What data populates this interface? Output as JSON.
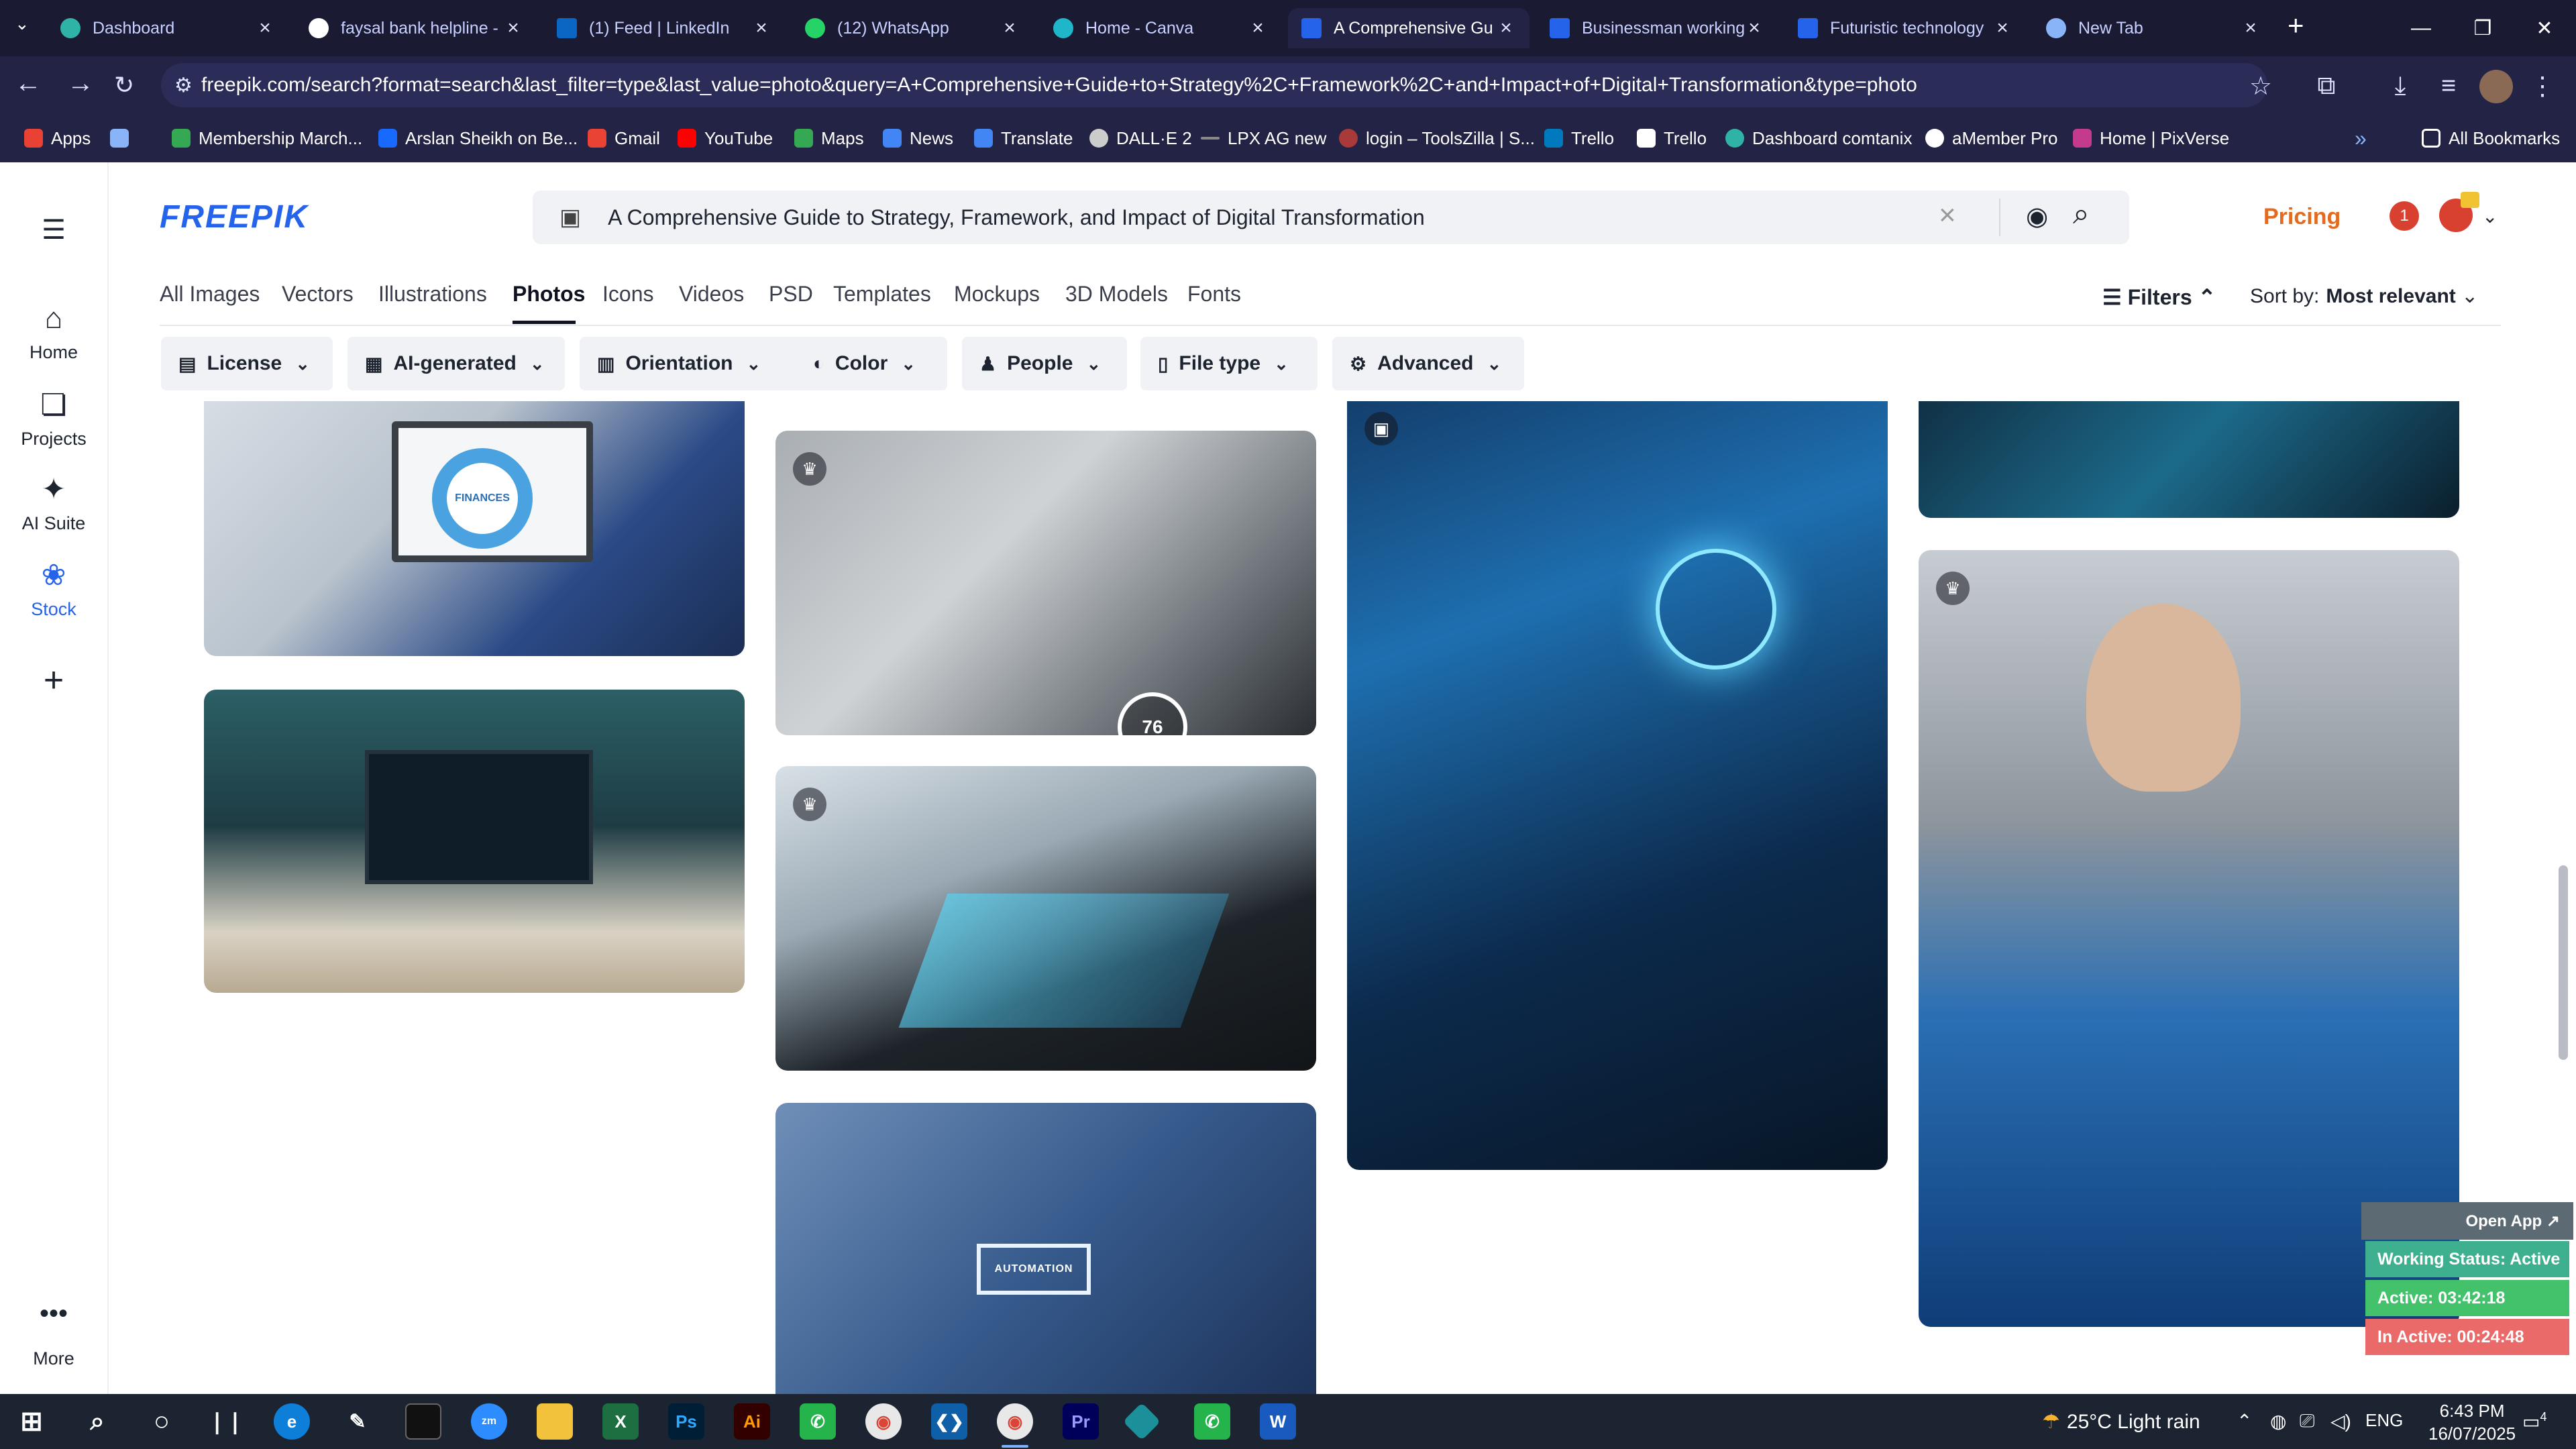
{
  "browser": {
    "tabs": [
      {
        "title": "Dashboard",
        "color": "#2fb3a6"
      },
      {
        "title": "faysal bank helpline -",
        "color": "#ffffff"
      },
      {
        "title": "(1) Feed | LinkedIn",
        "color": "#0a66c2"
      },
      {
        "title": "(12) WhatsApp",
        "color": "#25d366"
      },
      {
        "title": "Home - Canva",
        "color": "#1fb6c9"
      },
      {
        "title": "A Comprehensive Gu",
        "color": "#2563eb"
      },
      {
        "title": "Businessman working",
        "color": "#2563eb"
      },
      {
        "title": "Futuristic technology",
        "color": "#2563eb"
      },
      {
        "title": "New Tab",
        "color": "#8ab4f8"
      }
    ],
    "url": "freepik.com/search?format=search&last_filter=type&last_value=photo&query=A+Comprehensive+Guide+to+Strategy%2C+Framework%2C+and+Impact+of+Digital+Transformation&type=photo",
    "bookmarks": [
      {
        "label": "Apps",
        "color": "#e94235"
      },
      {
        "label": "",
        "color": "#8ab4f8"
      },
      {
        "label": "Membership March...",
        "color": "#34a853"
      },
      {
        "label": "Arslan Sheikh on Be...",
        "color": "#1769ff"
      },
      {
        "label": "Gmail",
        "color": "#ea4335"
      },
      {
        "label": "YouTube",
        "color": "#ff0000"
      },
      {
        "label": "Maps",
        "color": "#34a853"
      },
      {
        "label": "News",
        "color": "#4285f4"
      },
      {
        "label": "Translate",
        "color": "#4285f4"
      },
      {
        "label": "DALL·E 2",
        "color": "#cccccc"
      },
      {
        "label": "LPX AG new",
        "color": "#888888"
      },
      {
        "label": "login – ToolsZilla | S...",
        "color": "#a83a3a"
      },
      {
        "label": "Trello",
        "color": "#0079bf"
      },
      {
        "label": "Trello",
        "color": "#ffffff"
      },
      {
        "label": "Dashboard comtanix",
        "color": "#2fb3a6"
      },
      {
        "label": "aMember Pro",
        "color": "#ffffff"
      },
      {
        "label": "Home | PixVerse",
        "color": "#c43a8c"
      }
    ],
    "all_bookmarks": "All Bookmarks"
  },
  "sidebar": {
    "items": [
      {
        "label": "Home"
      },
      {
        "label": "Projects"
      },
      {
        "label": "AI Suite"
      },
      {
        "label": "Stock"
      },
      {
        "label": ""
      }
    ],
    "more": "More"
  },
  "header": {
    "logo": "FREEPIK",
    "search_value": "A Comprehensive Guide to Strategy, Framework, and Impact of Digital Transformation",
    "pricing": "Pricing",
    "notification_count": "1"
  },
  "categories": [
    "All Images",
    "Vectors",
    "Illustrations",
    "Photos",
    "Icons",
    "Videos",
    "PSD",
    "Templates",
    "Mockups",
    "3D Models",
    "Fonts"
  ],
  "selected_category": "Photos",
  "filters_label": "Filters",
  "sort": {
    "label": "Sort by:",
    "value": "Most relevant"
  },
  "filter_chips": [
    "License",
    "AI-generated",
    "Orientation",
    "Color",
    "People",
    "File type",
    "Advanced"
  ],
  "results": {
    "overlay_number": "76",
    "automation_label": "AUTOMATION",
    "finances_label": "FINANCES"
  },
  "widget": {
    "open_app": "Open App ↗",
    "status": "Working Status: Active",
    "active": "Active: 03:42:18",
    "inactive": "In Active: 00:24:48",
    "colors": {
      "status": "#3fb08f",
      "active": "#43c26b",
      "inactive": "#ea6a6a"
    }
  },
  "taskbar": {
    "weather": "25°C  Light rain",
    "lang": "ENG",
    "time": "6:43 PM",
    "date": "16/07/2025",
    "notif_count": "4"
  }
}
